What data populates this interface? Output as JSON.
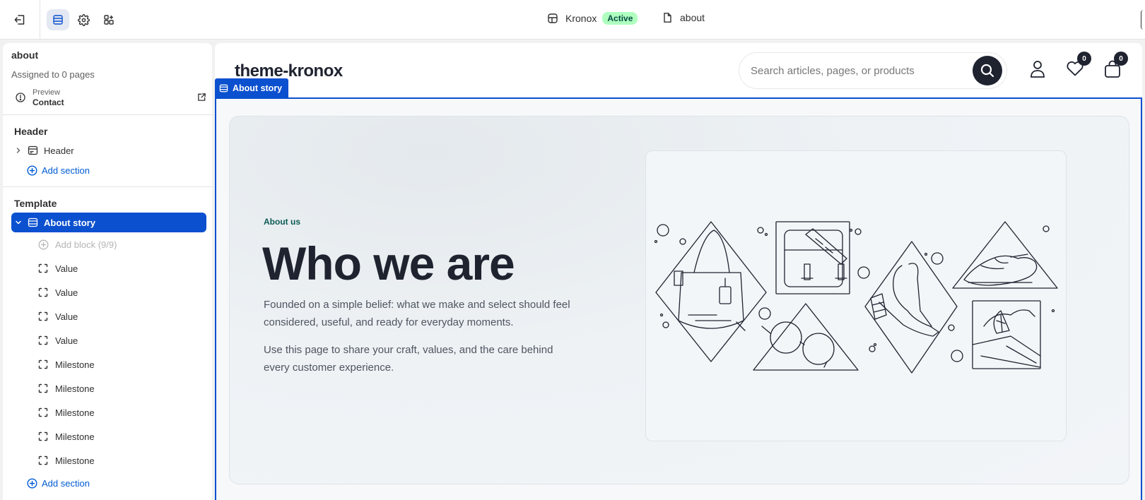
{
  "topbar": {
    "store_name": "Kronox",
    "store_status": "Active",
    "page_name": "about"
  },
  "sidebar": {
    "template_name": "about",
    "assigned_text": "Assigned to 0 pages",
    "preview_label": "Preview",
    "preview_value": "Contact",
    "header_group_title": "Header",
    "header_section": "Header",
    "add_section_label": "Add section",
    "template_group_title": "Template",
    "selected_section": "About story",
    "add_block_label": "Add block (9/9)",
    "blocks": [
      "Value",
      "Value",
      "Value",
      "Value",
      "Milestone",
      "Milestone",
      "Milestone",
      "Milestone",
      "Milestone"
    ]
  },
  "canvas": {
    "store_logo": "theme-kronox",
    "search_placeholder": "Search articles, pages, or products",
    "wishlist_count": "0",
    "cart_count": "0",
    "section_label": "About story",
    "eyebrow": "About us",
    "heading": "Who we are",
    "paragraph_1": "Founded on a simple belief: what we make and select should feel considered, useful, and ready for everyday moments.",
    "paragraph_2": "Use this page to share your craft, values, and the care behind every customer experience."
  },
  "colors": {
    "accent": "#0b50cf",
    "status_badge": "#affebf",
    "eyebrow": "#0c5a55",
    "heading": "#1f2330"
  }
}
